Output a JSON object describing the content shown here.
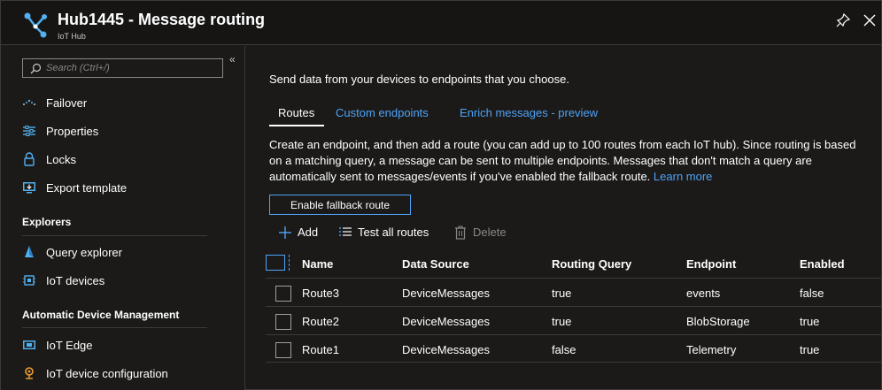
{
  "header": {
    "title": "Hub1445 - Message routing",
    "subtitle": "IoT Hub"
  },
  "sidebar": {
    "search_placeholder": "Search (Ctrl+/)",
    "collapse_glyph": "«",
    "items_top": [
      {
        "label": "Failover",
        "icon": "failover-icon"
      },
      {
        "label": "Properties",
        "icon": "properties-icon"
      },
      {
        "label": "Locks",
        "icon": "lock-icon"
      },
      {
        "label": "Export template",
        "icon": "export-template-icon"
      }
    ],
    "section_explorers": "Explorers",
    "items_explorers": [
      {
        "label": "Query explorer",
        "icon": "query-explorer-icon"
      },
      {
        "label": "IoT devices",
        "icon": "iot-devices-icon"
      }
    ],
    "section_adm": "Automatic Device Management",
    "items_adm": [
      {
        "label": "IoT Edge",
        "icon": "iot-edge-icon"
      },
      {
        "label": "IoT device configuration",
        "icon": "device-configuration-icon"
      }
    ]
  },
  "main": {
    "intro": "Send data from your devices to endpoints that you choose.",
    "tabs": [
      {
        "label": "Routes",
        "active": true
      },
      {
        "label": "Custom endpoints",
        "active": false
      },
      {
        "label": "Enrich messages - preview",
        "active": false
      }
    ],
    "description": "Create an endpoint, and then add a route (you can add up to 100 routes from each IoT hub). Since routing is based on a matching query, a message can be sent to multiple endpoints. Messages that don't match a query are automatically sent to messages/events if you've enabled the fallback route.",
    "learn_more": "Learn more",
    "fallback_button": "Enable fallback route",
    "toolbar": {
      "add": "Add",
      "test_all": "Test all routes",
      "delete": "Delete"
    },
    "table": {
      "columns": [
        "Name",
        "Data Source",
        "Routing Query",
        "Endpoint",
        "Enabled"
      ],
      "rows": [
        [
          "Route3",
          "DeviceMessages",
          "true",
          "events",
          "false"
        ],
        [
          "Route2",
          "DeviceMessages",
          "true",
          "BlobStorage",
          "true"
        ],
        [
          "Route1",
          "DeviceMessages",
          "false",
          "Telemetry",
          "true"
        ]
      ]
    }
  },
  "colors": {
    "background": "#1b1a19",
    "accent": "#4fa3f7",
    "border": "#3b3a39"
  }
}
